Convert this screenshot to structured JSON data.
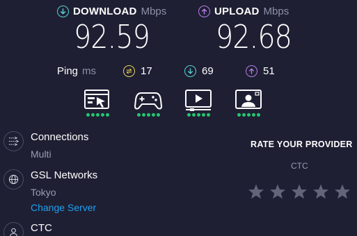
{
  "download": {
    "label": "DOWNLOAD",
    "unit": "Mbps",
    "value": "92.59",
    "icon": "download-arrow-icon",
    "color": "#58d3d0"
  },
  "upload": {
    "label": "UPLOAD",
    "unit": "Mbps",
    "value": "92.68",
    "icon": "upload-arrow-icon",
    "color": "#b77ee8"
  },
  "ping": {
    "label": "Ping",
    "unit": "ms",
    "idle": {
      "value": "17",
      "icon": "idle-latency-icon",
      "color": "#e8d35a"
    },
    "download": {
      "value": "69",
      "icon": "download-latency-icon",
      "color": "#58d3d0"
    },
    "upload": {
      "value": "51",
      "icon": "upload-latency-icon",
      "color": "#b77ee8"
    }
  },
  "features": [
    {
      "icon": "web-browsing-icon",
      "rating": 5
    },
    {
      "icon": "gaming-controller-icon",
      "rating": 5
    },
    {
      "icon": "video-streaming-icon",
      "rating": 5
    },
    {
      "icon": "video-chat-icon",
      "rating": 5
    }
  ],
  "connections": {
    "title": "Connections",
    "value": "Multi",
    "icon": "connections-icon"
  },
  "server": {
    "title": "GSL Networks",
    "location": "Tokyo",
    "change_label": "Change Server",
    "icon": "globe-icon"
  },
  "provider": {
    "title": "CTC",
    "icon": "user-icon"
  },
  "rate": {
    "title": "RATE YOUR PROVIDER",
    "isp": "CTC",
    "star_count": 5,
    "star_color": "#62647a"
  },
  "colors": {
    "background": "#1e1f33",
    "accent_link": "#1ea1f2",
    "dot_green": "#26c56f"
  }
}
